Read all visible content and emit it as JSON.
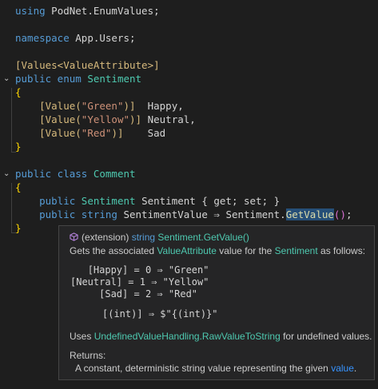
{
  "code": {
    "using_kw": "using",
    "using_ns": "PodNet.EnumValues;",
    "namespace_kw": "namespace",
    "namespace_name": "App.Users;",
    "attr_open": "[",
    "attr_name": "Values<ValueAttribute>",
    "attr_close": "]",
    "enum_decl_kw": "public enum",
    "enum_name": "Sentiment",
    "open_brace": "{",
    "close_brace": "}",
    "enum_members": [
      {
        "attr_prefix": "[Value(",
        "value": "\"Green\"",
        "attr_suffix": ")]",
        "pad": "  ",
        "name": "Happy,"
      },
      {
        "attr_prefix": "[Value(",
        "value": "\"Yellow\"",
        "attr_suffix": ")]",
        "pad": " ",
        "name": "Neutral,"
      },
      {
        "attr_prefix": "[Value(",
        "value": "\"Red\"",
        "attr_suffix": ")]",
        "pad": "    ",
        "name": "Sad"
      }
    ],
    "class_decl_kw": "public class",
    "class_name": "Comment",
    "prop1_kw": "public",
    "prop1_type": "Sentiment",
    "prop1_name": "Sentiment",
    "prop1_accessors": "{ get; set; }",
    "prop2_kw1": "public",
    "prop2_kw2": "string",
    "prop2_name": "SentimentValue",
    "prop2_arrow": "⇒",
    "prop2_target": "Sentiment.",
    "prop2_method": "GetValue",
    "prop2_parens": "()",
    "prop2_end": ";"
  },
  "tooltip": {
    "signature_prefix": "(extension)",
    "signature_type": "string",
    "signature_member": "Sentiment.GetValue()",
    "summary_1": "Gets the associated",
    "summary_link_1": "ValueAttribute",
    "summary_2": "value for the",
    "summary_link_2": "Sentiment",
    "summary_3": "as follows:",
    "mappings": [
      {
        "key": "[Happy]",
        "pad": "   ",
        "num": "0",
        "value": "\"Green\""
      },
      {
        "key": "[Neutral]",
        "pad": "",
        "num": "1",
        "value": "\"Yellow\""
      },
      {
        "key": "[Sad]",
        "pad": "     ",
        "num": "2",
        "value": "\"Red\""
      }
    ],
    "eq": "=",
    "arrow": "⇒",
    "fallback_left": "[(int)]",
    "fallback_right": "$\"{(int)}\"",
    "undefined_1": "Uses",
    "undefined_link_1": "UndefinedValueHandling",
    "undefined_link_2": ".RawValueToString",
    "undefined_2": "for undefined values.",
    "returns_label": "Returns:",
    "returns_text": "A constant, deterministic string value representing the given",
    "returns_link": "value",
    "returns_end": "."
  },
  "colors": {
    "background": "#1e1e1e",
    "keyword": "#569cd6",
    "type": "#4ec9b0",
    "string": "#ce9178",
    "attribute": "#d7ba7d",
    "selection": "#264f78",
    "tooltip_bg": "#252526"
  }
}
